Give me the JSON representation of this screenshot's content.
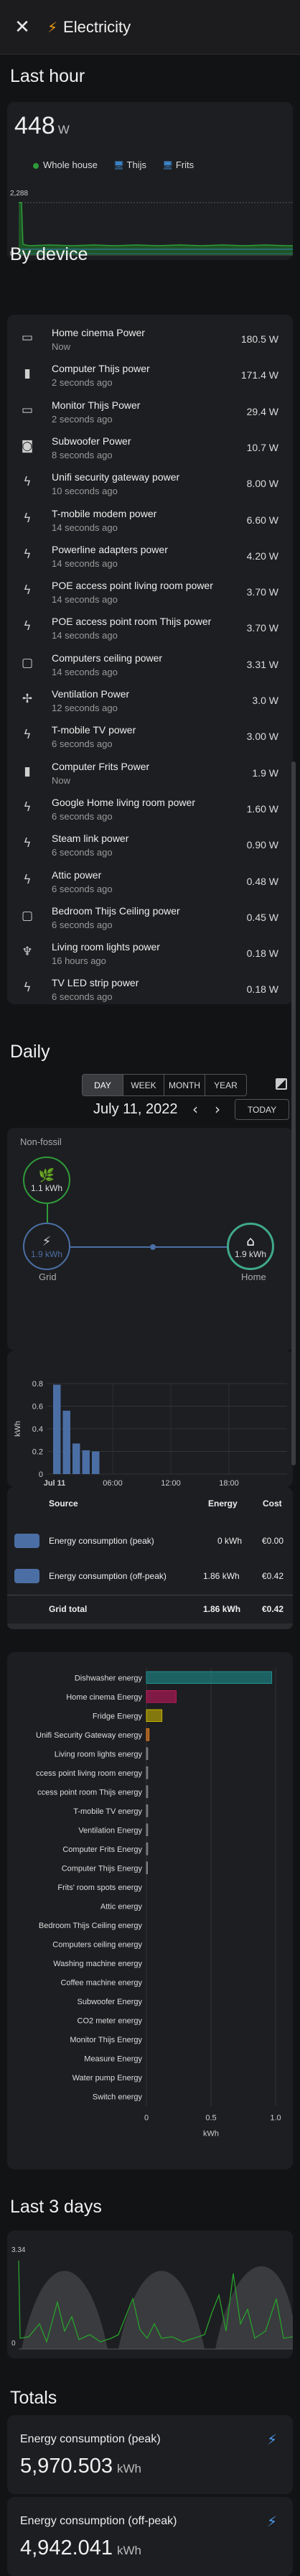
{
  "header": {
    "title": "Electricity",
    "close_icon": "close-icon",
    "bolt_icon": "lightning-bolt-icon"
  },
  "last_hour": {
    "title": "Last hour",
    "value": "448",
    "unit": "W",
    "y_max_label": "2,288",
    "y_min_label": "0",
    "legend": [
      {
        "label": "Whole house",
        "color": "#2e9b3a"
      },
      {
        "label": "Thijs",
        "color": "#3b82c4"
      },
      {
        "label": "Frits",
        "color": "#2b6d7a"
      }
    ]
  },
  "by_device": {
    "title": "By device",
    "items": [
      {
        "name": "Home cinema Power",
        "time": "Now",
        "value": "180.5 W",
        "icon": "television-icon"
      },
      {
        "name": "Computer Thijs power",
        "time": "2 seconds ago",
        "value": "171.4 W",
        "icon": "desktop-tower-icon"
      },
      {
        "name": "Monitor Thijs Power",
        "time": "2 seconds ago",
        "value": "29.4 W",
        "icon": "monitor-icon"
      },
      {
        "name": "Subwoofer Power",
        "time": "8 seconds ago",
        "value": "10.7 W",
        "icon": "speaker-icon"
      },
      {
        "name": "Unifi security gateway power",
        "time": "10 seconds ago",
        "value": "8.00 W",
        "icon": "flash-icon"
      },
      {
        "name": "T-mobile modem power",
        "time": "14 seconds ago",
        "value": "6.60 W",
        "icon": "flash-icon"
      },
      {
        "name": "Powerline adapters power",
        "time": "14 seconds ago",
        "value": "4.20 W",
        "icon": "flash-icon"
      },
      {
        "name": "POE access point living room power",
        "time": "14 seconds ago",
        "value": "3.70 W",
        "icon": "flash-icon"
      },
      {
        "name": "POE access point room Thijs power",
        "time": "14 seconds ago",
        "value": "3.70 W",
        "icon": "flash-icon"
      },
      {
        "name": "Computers ceiling power",
        "time": "14 seconds ago",
        "value": "3.31 W",
        "icon": "checkbox-blank-icon"
      },
      {
        "name": "Ventilation Power",
        "time": "12 seconds ago",
        "value": "3.0 W",
        "icon": "fan-icon"
      },
      {
        "name": "T-mobile TV power",
        "time": "6 seconds ago",
        "value": "3.00 W",
        "icon": "flash-icon"
      },
      {
        "name": "Computer Frits Power",
        "time": "Now",
        "value": "1.9 W",
        "icon": "desktop-tower-icon"
      },
      {
        "name": "Google Home living room power",
        "time": "6 seconds ago",
        "value": "1.60 W",
        "icon": "flash-icon"
      },
      {
        "name": "Steam link power",
        "time": "6 seconds ago",
        "value": "0.90 W",
        "icon": "flash-icon"
      },
      {
        "name": "Attic power",
        "time": "6 seconds ago",
        "value": "0.48 W",
        "icon": "flash-icon"
      },
      {
        "name": "Bedroom Thijs Ceiling power",
        "time": "6 seconds ago",
        "value": "0.45 W",
        "icon": "checkbox-blank-icon"
      },
      {
        "name": "Living room lights power",
        "time": "16 hours ago",
        "value": "0.18 W",
        "icon": "ceiling-light-icon"
      },
      {
        "name": "TV LED strip power",
        "time": "6 seconds ago",
        "value": "0.18 W",
        "icon": "flash-icon"
      }
    ]
  },
  "daily": {
    "title": "Daily",
    "periods": [
      "DAY",
      "WEEK",
      "MONTH",
      "YEAR"
    ],
    "active_period": "DAY",
    "compare_icon": "calendar-compare-icon",
    "date": "July 11, 2022",
    "prev_icon": "chevron-left-icon",
    "next_icon": "chevron-right-icon",
    "today": "TODAY",
    "flow": {
      "nonfossil_label": "Non-fossil",
      "nonfossil_value": "1.1 kWh",
      "grid_label": "Grid",
      "grid_value": "1.9 kWh",
      "home_label": "Home",
      "home_value": "1.9 kWh"
    },
    "table": {
      "headers": [
        "Source",
        "Energy",
        "Cost"
      ],
      "rows": [
        {
          "source": "Energy consumption (peak)",
          "energy": "0 kWh",
          "cost": "€0.00"
        },
        {
          "source": "Energy consumption (off-peak)",
          "energy": "1.86 kWh",
          "cost": "€0.42"
        }
      ],
      "total": {
        "label": "Grid total",
        "energy": "1.86 kWh",
        "cost": "€0.42"
      }
    }
  },
  "chart_data": [
    {
      "type": "bar",
      "title": "",
      "ylabel": "kWh",
      "ylim": [
        0,
        0.8
      ],
      "yticks": [
        "0",
        "0.2",
        "0.4",
        "0.6",
        "0.8"
      ],
      "xticks": [
        "Jul 11",
        "06:00",
        "12:00",
        "18:00"
      ],
      "categories": [
        "00:00",
        "01:00",
        "02:00",
        "03:00",
        "04:00"
      ],
      "series": [
        {
          "values": [
            0.79,
            0.56,
            0.27,
            0.21,
            0.2
          ]
        }
      ]
    },
    {
      "type": "bar",
      "orientation": "horizontal",
      "xlabel": "kWh",
      "xlim": [
        0,
        1.0
      ],
      "xticks": [
        "0",
        "0.5",
        "1.0"
      ],
      "categories": [
        "Dishwasher energy",
        "Home cinema Energy",
        "Fridge Energy",
        "Unifi Security Gateway energy",
        "Living room lights energy",
        "ccess point living room energy",
        "ccess point room Thijs energy",
        "T-mobile TV energy",
        "Ventilation Energy",
        "Computer Frits Energy",
        "Computer Thijs Energy",
        "Frits' room spots energy",
        "Attic energy",
        "Bedroom Thijs Ceiling energy",
        "Computers ceiling energy",
        "Washing machine energy",
        "Coffee machine energy",
        "Subwoofer Energy",
        "CO2 meter energy",
        "Monitor Thijs Energy",
        "Measure Energy",
        "Water pump Energy",
        "Switch energy"
      ],
      "values": [
        0.97,
        0.23,
        0.12,
        0.02,
        0.01,
        0.01,
        0.01,
        0.01,
        0.01,
        0.01,
        0.005,
        0,
        0,
        0,
        0,
        0,
        0,
        0,
        0,
        0,
        0,
        0,
        0
      ],
      "colors": [
        "#1e8f8f",
        "#c2185b",
        "#c8b400",
        "#e67e22",
        "#888",
        "#888",
        "#888",
        "#888",
        "#888",
        "#888",
        "#888"
      ]
    },
    {
      "type": "area",
      "title": "Last 3 days",
      "y_max_label": "3.34",
      "y_min_label": "0"
    }
  ],
  "totals": {
    "title": "Totals",
    "items": [
      {
        "name": "Energy consumption (peak)",
        "value": "5,970.503",
        "unit": "kWh"
      },
      {
        "name": "Energy consumption (off-peak)",
        "value": "4,942.041",
        "unit": "kWh"
      }
    ]
  }
}
